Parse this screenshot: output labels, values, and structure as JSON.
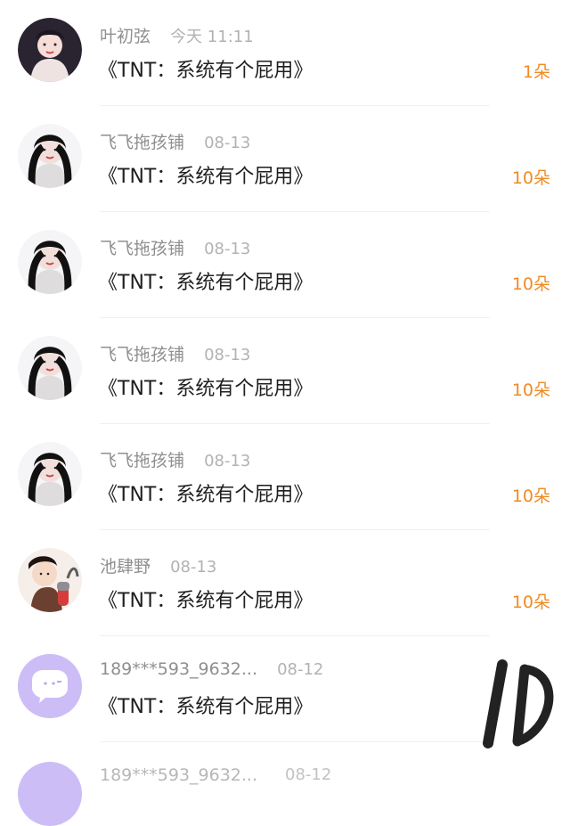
{
  "messages": [
    {
      "name": "叶初弦",
      "time": "今天 11:11",
      "title": "《TNT：系统有个屁用》",
      "amount": "1朵",
      "avatar": "girl-avatar"
    },
    {
      "name": "飞飞拖孩铺",
      "time": "08-13",
      "title": "《TNT：系统有个屁用》",
      "amount": "10朵",
      "avatar": "girl-avatar"
    },
    {
      "name": "飞飞拖孩铺",
      "time": "08-13",
      "title": "《TNT：系统有个屁用》",
      "amount": "10朵",
      "avatar": "girl-avatar"
    },
    {
      "name": "飞飞拖孩铺",
      "time": "08-13",
      "title": "《TNT：系统有个屁用》",
      "amount": "10朵",
      "avatar": "girl-avatar"
    },
    {
      "name": "飞飞拖孩铺",
      "time": "08-13",
      "title": "《TNT：系统有个屁用》",
      "amount": "10朵",
      "avatar": "girl-avatar"
    },
    {
      "name": "池肆野",
      "time": "08-13",
      "title": "《TNT：系统有个屁用》",
      "amount": "10朵",
      "avatar": "photo-avatar"
    },
    {
      "name": "189***593_9632...",
      "time": "08-12",
      "title": "《TNT：系统有个屁用》",
      "amount": "",
      "avatar": "chat-bubble-avatar"
    }
  ],
  "partial": {
    "name": "189***593_9632...",
    "time": "08-12"
  },
  "watermark": "ID",
  "colors": {
    "amount": "#f08a24",
    "name": "#8f8f8f",
    "time": "#b2b2b2",
    "title": "#1f1f1f",
    "bubble_avatar_bg": "#cdbdf7"
  }
}
